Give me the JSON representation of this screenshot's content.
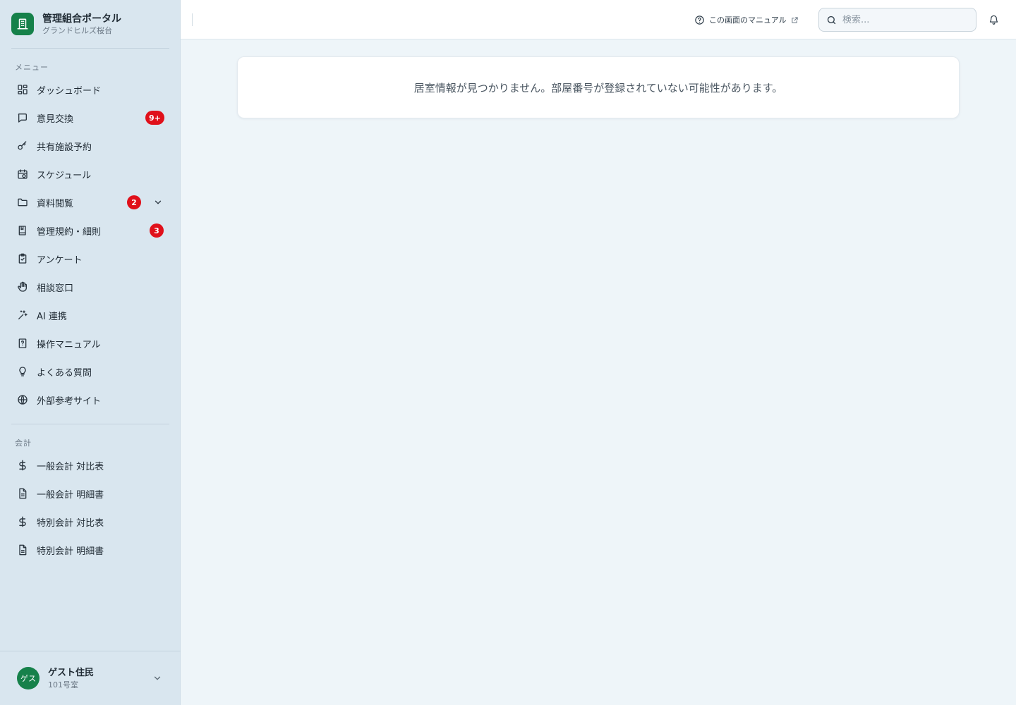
{
  "brand": {
    "title": "管理組合ポータル",
    "subtitle": "グランドヒルズ桜台"
  },
  "sidebar": {
    "menu_label": "メニュー",
    "items": [
      {
        "label": "ダッシュボード",
        "icon": "dashboard-grid-icon"
      },
      {
        "label": "意見交換",
        "icon": "chat-bubble-icon",
        "badge": "9+"
      },
      {
        "label": "共有施設予約",
        "icon": "key-icon"
      },
      {
        "label": "スケジュール",
        "icon": "calendar-clock-icon"
      },
      {
        "label": "資料閲覧",
        "icon": "folder-icon",
        "badge": "2",
        "expandable": true
      },
      {
        "label": "管理規約・細則",
        "icon": "book-icon",
        "badge": "3"
      },
      {
        "label": "アンケート",
        "icon": "clipboard-check-icon"
      },
      {
        "label": "相談窓口",
        "icon": "hand-icon"
      },
      {
        "label": "AI 連携",
        "icon": "sparkles-icon"
      },
      {
        "label": "操作マニュアル",
        "icon": "manual-book-icon"
      },
      {
        "label": "よくある質問",
        "icon": "lightbulb-icon"
      },
      {
        "label": "外部参考サイト",
        "icon": "globe-icon"
      }
    ],
    "accounting_label": "会計",
    "accounting_items": [
      {
        "label": "一般会計 対比表",
        "icon": "dollar-icon"
      },
      {
        "label": "一般会計 明細書",
        "icon": "document-icon"
      },
      {
        "label": "特別会計 対比表",
        "icon": "dollar-icon"
      },
      {
        "label": "特別会計 明細書",
        "icon": "document-icon"
      }
    ]
  },
  "user": {
    "avatar_text": "ゲス",
    "name": "ゲスト住民",
    "room": "101号室"
  },
  "header": {
    "manual_link": "この画面のマニュアル",
    "search_placeholder": "検索..."
  },
  "main": {
    "notice": "居室情報が見つかりません。部屋番号が登録されていない可能性があります。"
  },
  "colors": {
    "brand_green": "#16814a",
    "badge_red": "#e0101a",
    "sidebar_bg": "#d9e6ef",
    "main_bg": "#eef5f9"
  }
}
